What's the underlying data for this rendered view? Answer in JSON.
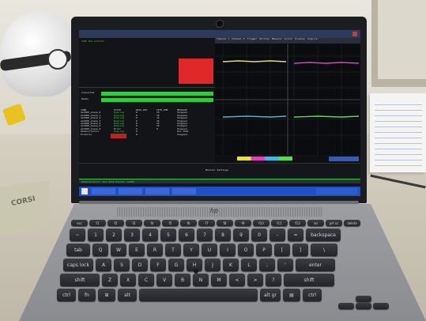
{
  "scene": {
    "description_free": true
  },
  "laptop": {
    "brand_logo": "hp"
  },
  "scope_app": {
    "title_bar": "TLRC Run Control",
    "channel_tabs": [
      "Channel 1",
      "Channel 2",
      "Trigger",
      "Utility",
      "Measure",
      "Cursor",
      "Display",
      "Acquire"
    ],
    "buttons": [
      "6 Run Control",
      "A4 Event Display"
    ],
    "table_header": [
      "CHAN",
      "STATE",
      "DATA_RDY",
      "FIFO_EMP",
      "MESSAGE"
    ],
    "table_rows": [
      [
        "ALPIDE_plane_0",
        "Running",
        "0",
        "15",
        "Stopped"
      ],
      [
        "ALPIDE_plane_1",
        "Running",
        "0",
        "15",
        "Stopped"
      ],
      [
        "ALPIDE_plane_2",
        "Running",
        "0",
        "15",
        "Stopped"
      ],
      [
        "ALPIDE_plane_3",
        "Running",
        "0",
        "15",
        "Stopped"
      ],
      [
        "ALPIDE_plane_4",
        "Running",
        "0",
        "15",
        "Stopped"
      ],
      [
        "ALPIDE_plane_5",
        "Running",
        "0",
        "15",
        "Stopped"
      ],
      [
        "ALPIDE_plane_6",
        "Error",
        "0",
        "0",
        "Stopped"
      ],
      [
        "DataCollector",
        "Running",
        "0",
        "",
        "Run 1542"
      ],
      [
        "Producer",
        "Running",
        "0",
        "",
        "Stopped"
      ]
    ],
    "status_lines": [
      "Connected",
      "Ready"
    ],
    "bottom_header": "Monitor Settings",
    "bottom_line": "DataCollector: Run 1542   Events: 15284"
  },
  "colors": {
    "trace_yellow": "#e8e23a",
    "trace_magenta": "#e040c0",
    "trace_cyan": "#3ab8e8",
    "trace_green": "#4ee04e",
    "red_box": "#e02828",
    "green_bar": "#2ecc40",
    "taskbar_blue": "#1e50c8"
  },
  "keyboard": {
    "row0": [
      "esc",
      "f1",
      "f2",
      "f3",
      "f4",
      "f5",
      "f6",
      "f7",
      "f8",
      "f9",
      "f10",
      "f11",
      "f12",
      "ins",
      "prt sc",
      "delete"
    ],
    "row1": [
      "~",
      "1",
      "2",
      "3",
      "4",
      "5",
      "6",
      "7",
      "8",
      "9",
      "0",
      "-",
      "=",
      "backspace"
    ],
    "row2": [
      "tab",
      "Q",
      "W",
      "E",
      "R",
      "T",
      "Y",
      "U",
      "I",
      "O",
      "P",
      "[",
      "]",
      "\\"
    ],
    "row3": [
      "caps lock",
      "A",
      "S",
      "D",
      "F",
      "G",
      "H",
      "J",
      "K",
      "L",
      ";",
      "'",
      "enter"
    ],
    "row4": [
      "shift",
      "Z",
      "X",
      "C",
      "V",
      "B",
      "N",
      "M",
      "<",
      ">",
      "?",
      "shift"
    ],
    "row5": [
      "ctrl",
      "fn",
      "⊞",
      "alt",
      "",
      "alt gr",
      "▤",
      "ctrl"
    ]
  },
  "left_card_text": "CORSI"
}
